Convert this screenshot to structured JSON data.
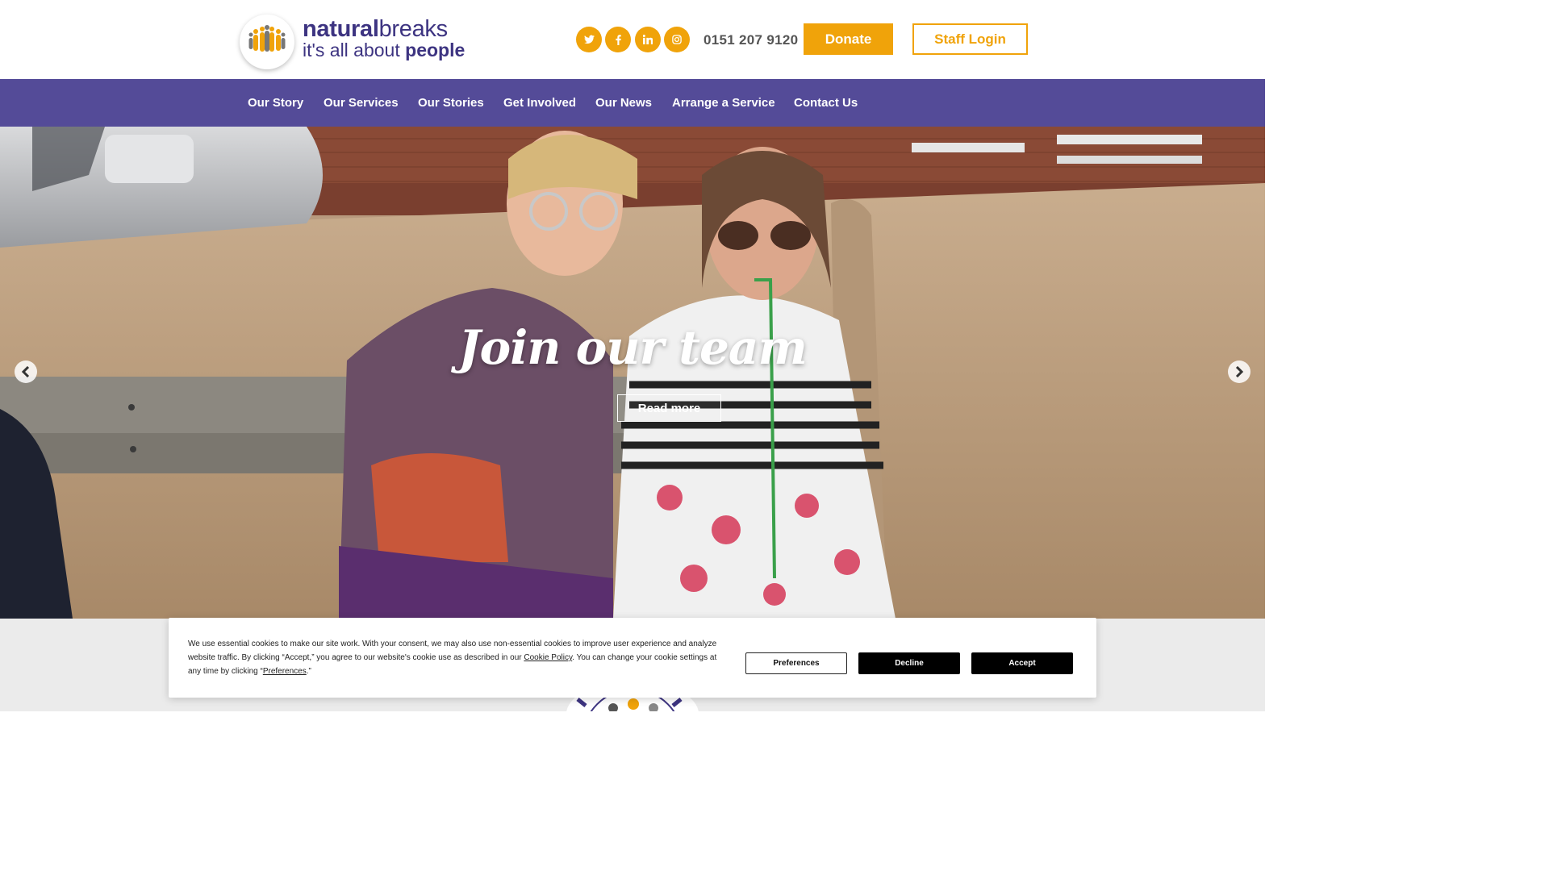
{
  "brand": {
    "name_bold": "natural",
    "name_regular": "breaks",
    "tagline_regular": "it's all about ",
    "tagline_bold": "people"
  },
  "header": {
    "social": [
      "twitter-icon",
      "facebook-icon",
      "linkedin-icon",
      "instagram-icon"
    ],
    "phone": "0151 207 9120",
    "donate_label": "Donate",
    "staff_login_label": "Staff Login"
  },
  "nav": {
    "items": [
      {
        "label": "Our Story"
      },
      {
        "label": "Our Services"
      },
      {
        "label": "Our Stories"
      },
      {
        "label": "Get Involved"
      },
      {
        "label": "Our News"
      },
      {
        "label": "Arrange a Service"
      },
      {
        "label": "Contact Us"
      }
    ]
  },
  "hero": {
    "title": "Join our team",
    "cta_label": "Read more",
    "prev_icon": "chevron-left-icon",
    "next_icon": "chevron-right-icon"
  },
  "cookie": {
    "text_part1": "We use essential cookies to make our site work. With your consent, we may also use non-essential cookies to improve user experience and analyze website traffic. By clicking “Accept,” you agree to our website's cookie use as described in our ",
    "policy_link": "Cookie Policy",
    "text_part2": ". You can change your cookie settings at any time by clicking “",
    "preferences_link": "Preferences",
    "text_part3": ".”",
    "buttons": {
      "preferences": "Preferences",
      "decline": "Decline",
      "accept": "Accept"
    }
  },
  "colors": {
    "brand_purple": "#544b98",
    "logo_purple": "#3d3481",
    "accent_orange": "#f0a30a"
  }
}
